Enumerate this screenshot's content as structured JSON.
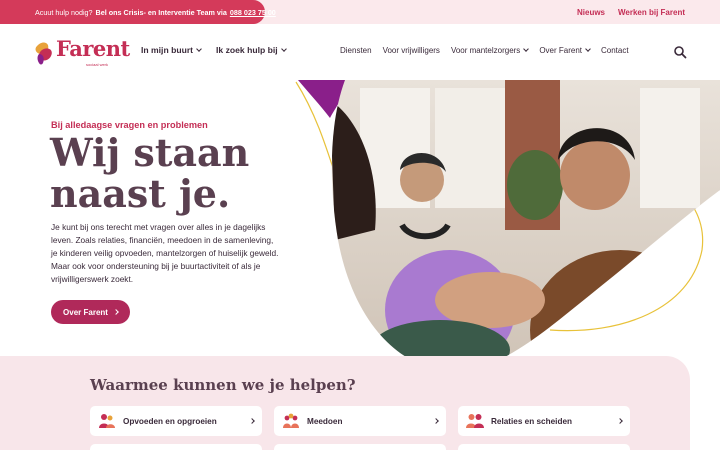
{
  "topbar": {
    "alert_prefix": "Acuut hulp nodig?",
    "alert_bold": "Bel ons Crisis- en Interventie Team via",
    "alert_phone": "088 023 75 00",
    "links": [
      "Nieuws",
      "Werken bij Farent"
    ]
  },
  "header": {
    "logo_text": "Farent",
    "logo_sub": "sociaal werk",
    "nav_left": [
      {
        "label": "In mijn buurt",
        "dropdown": true
      },
      {
        "label": "Ik zoek hulp bij",
        "dropdown": true
      }
    ],
    "nav_right": [
      {
        "label": "Diensten",
        "dropdown": false
      },
      {
        "label": "Voor vrijwilligers",
        "dropdown": false
      },
      {
        "label": "Voor mantelzorgers",
        "dropdown": true
      },
      {
        "label": "Over Farent",
        "dropdown": true
      },
      {
        "label": "Contact",
        "dropdown": false
      }
    ],
    "search_icon": "search-icon"
  },
  "hero": {
    "eyebrow": "Bij alledaagse vragen en problemen",
    "headline": "Wij staan naast je.",
    "body": "Je kunt bij ons terecht met vragen over alles in je dagelijks leven. Zoals relaties, financiën, meedoen in de samenleving, je kinderen veilig opvoeden, mantelzorgen of huiselijk geweld. Maar ook voor ondersteuning bij je buurtactiviteit of als je vrijwilligerswerk zoekt.",
    "cta_label": "Over Farent"
  },
  "services": {
    "title": "Waarmee kunnen we je helpen?",
    "cards": [
      {
        "label": "Opvoeden en opgroeien",
        "icon": "family-icon"
      },
      {
        "label": "Meedoen",
        "icon": "group-icon"
      },
      {
        "label": "Relaties en scheiden",
        "icon": "couple-icon"
      }
    ]
  },
  "colors": {
    "brand": "#c42e55",
    "cta": "#b0295a",
    "purple": "#8a1f8a",
    "heading": "#5a4050",
    "pink_bg": "#f8e6ea",
    "yellow_line": "#e8c23a"
  }
}
